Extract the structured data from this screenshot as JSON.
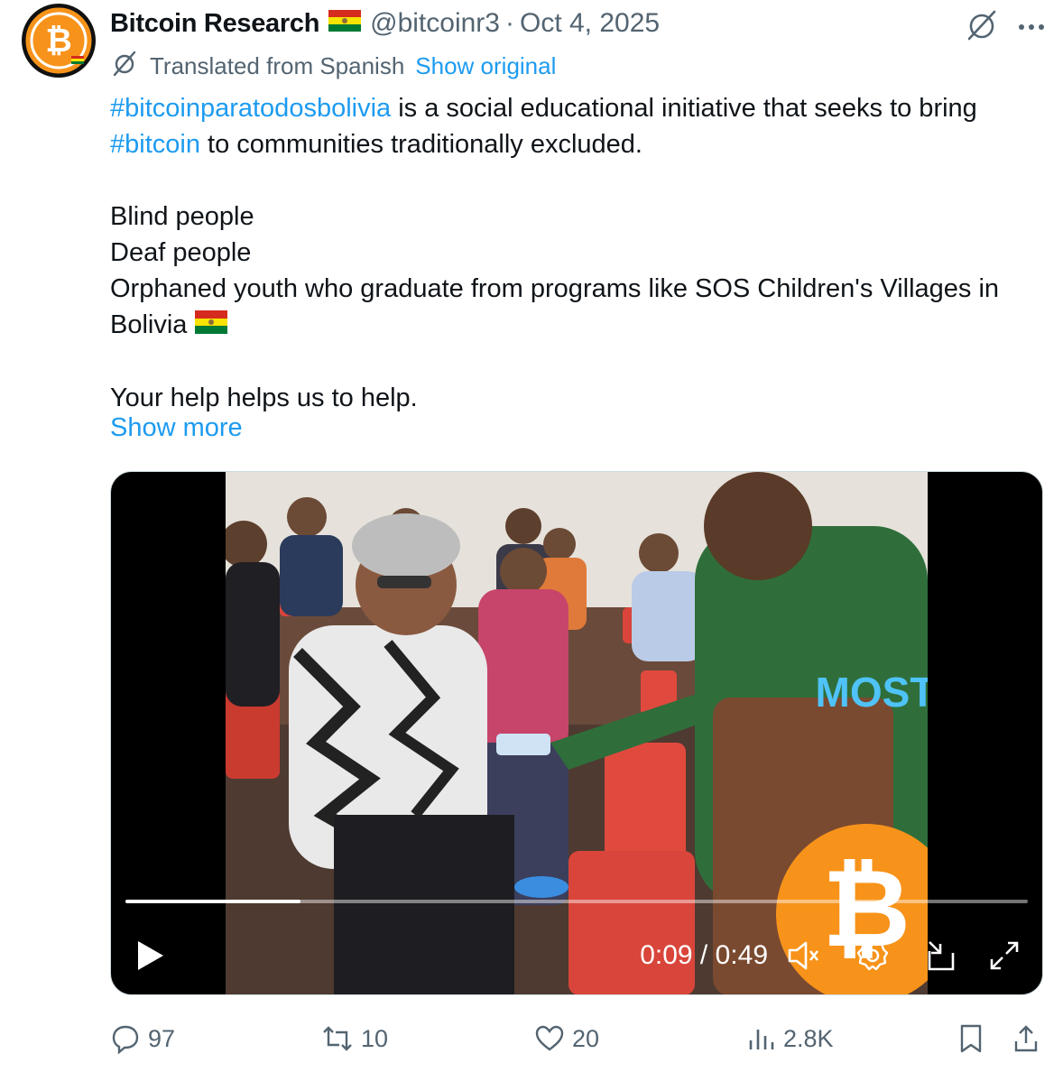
{
  "author": {
    "name": "Bitcoin Research",
    "handle": "@bitcoinr3",
    "separator": "·",
    "date": "Oct 4, 2025"
  },
  "translation": {
    "note": "Translated from Spanish",
    "show_original": "Show original"
  },
  "tweet": {
    "hashtag1": "#bitcoinparatodosbolivia",
    "line1_rest": " is a social educational initiative that seeks to bring ",
    "hashtag2": "#bitcoin",
    "line1_end": " to communities traditionally excluded.",
    "item1": "Blind people",
    "item2": "Deaf people",
    "item3": "Orphaned youth who graduate from programs like SOS Children's Villages in Bolivia",
    "closing": "Your help helps us to help.",
    "show_more": "Show more"
  },
  "video": {
    "current_time": "0:09",
    "separator": "/",
    "duration": "0:49",
    "progress_fraction": 0.194,
    "shirt_text": "MOST"
  },
  "actions": {
    "replies": "97",
    "reposts": "10",
    "likes": "20",
    "views": "2.8K"
  },
  "colors": {
    "accent": "#1d9bf0",
    "muted": "#536471",
    "bitcoin_orange": "#f7931a"
  }
}
